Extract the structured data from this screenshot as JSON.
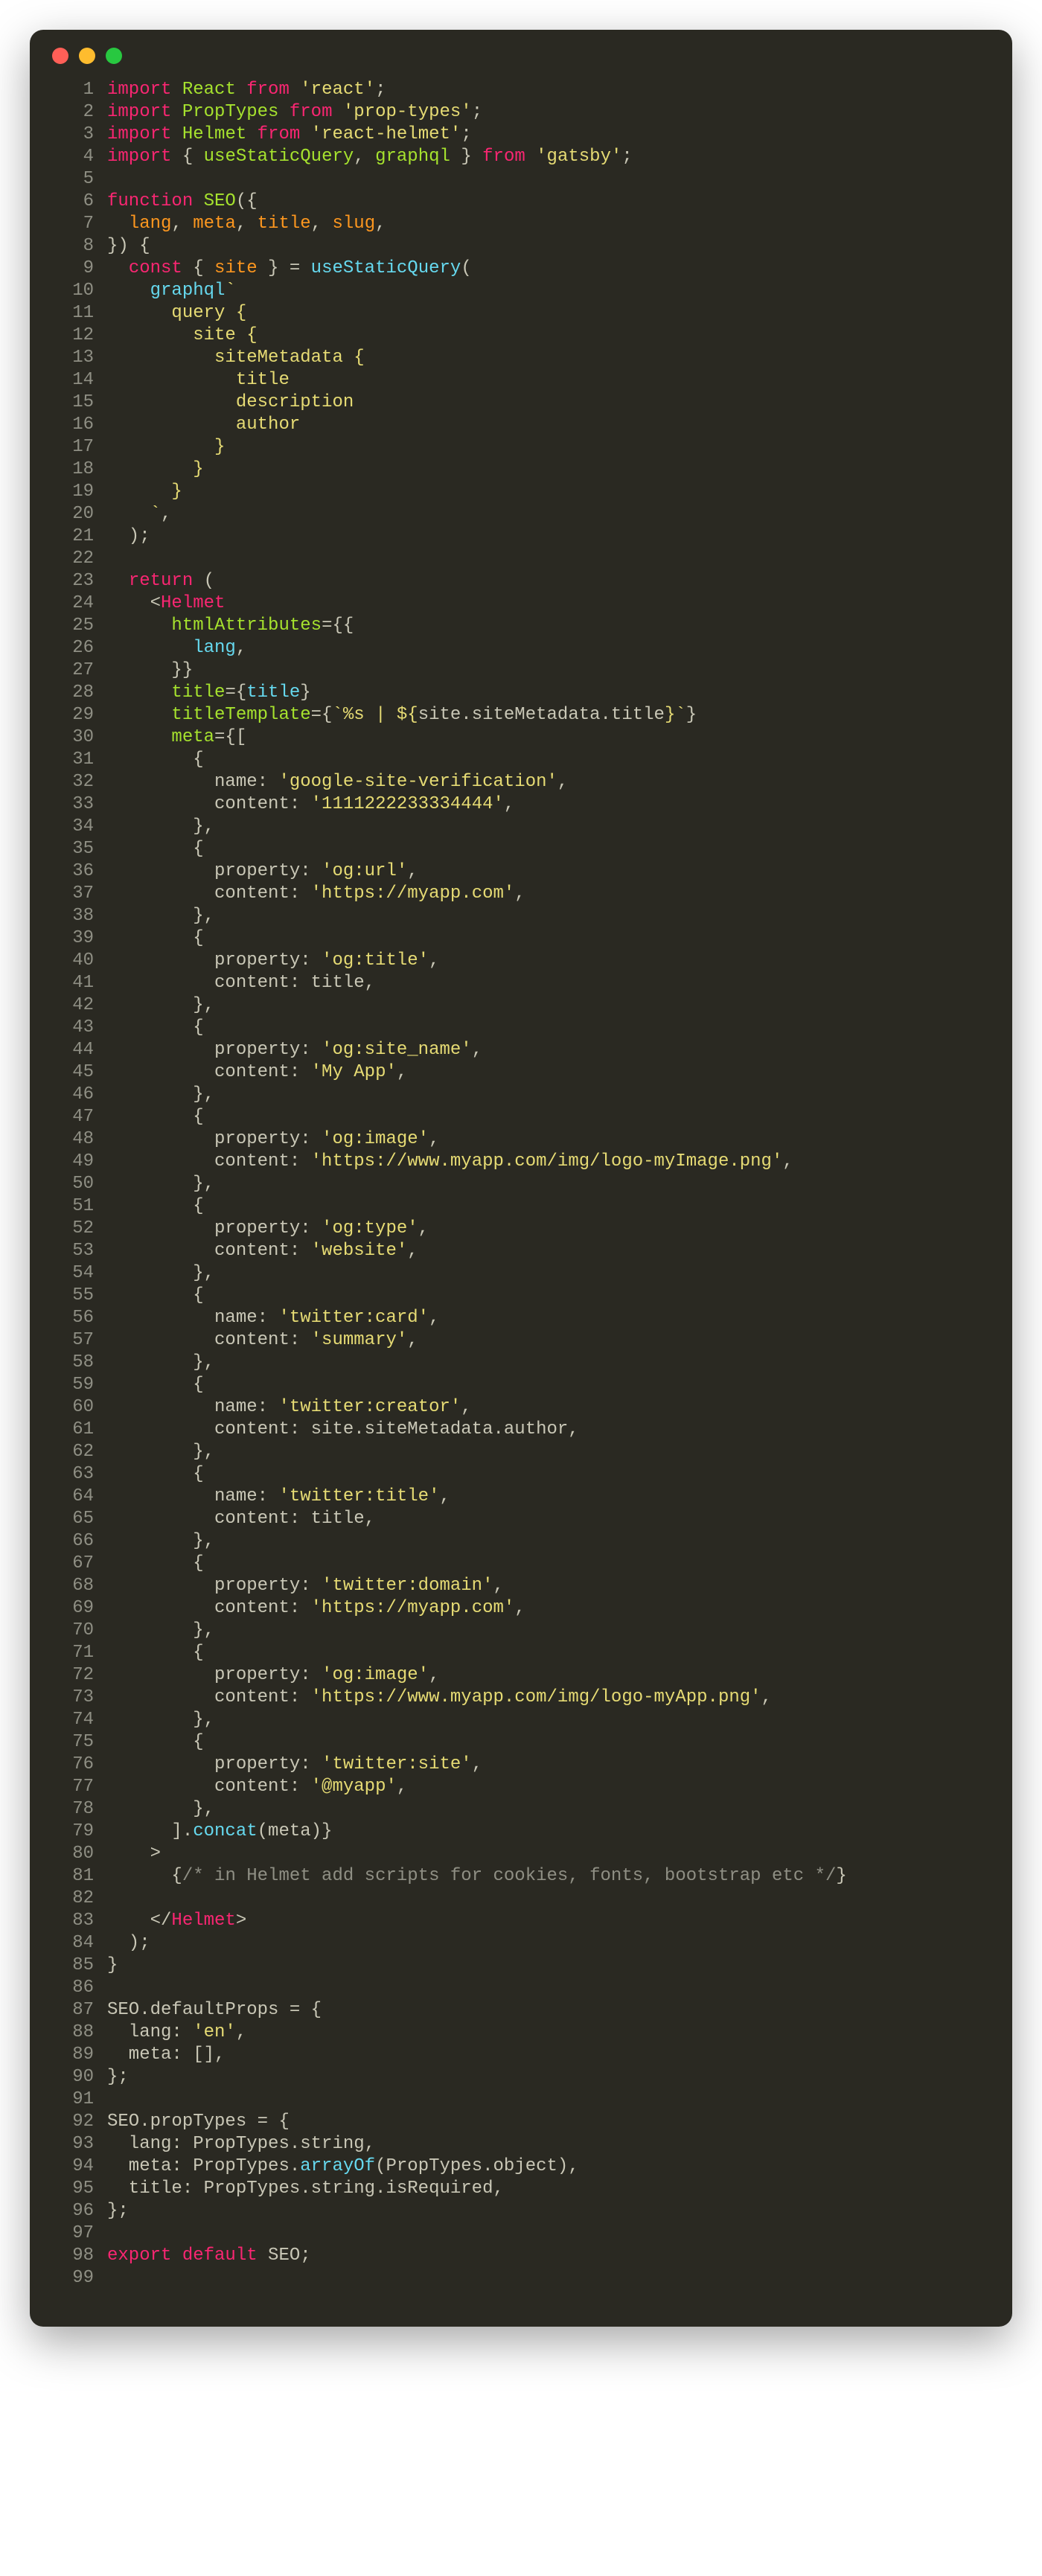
{
  "window": {
    "dots": [
      "close",
      "minimize",
      "zoom"
    ]
  },
  "code": {
    "lines": [
      [
        [
          "kw",
          "import"
        ],
        [
          "punc",
          " "
        ],
        [
          "name",
          "React"
        ],
        [
          "punc",
          " "
        ],
        [
          "kw",
          "from"
        ],
        [
          "punc",
          " "
        ],
        [
          "str",
          "'react'"
        ],
        [
          "punc",
          ";"
        ]
      ],
      [
        [
          "kw",
          "import"
        ],
        [
          "punc",
          " "
        ],
        [
          "name",
          "PropTypes"
        ],
        [
          "punc",
          " "
        ],
        [
          "kw",
          "from"
        ],
        [
          "punc",
          " "
        ],
        [
          "str",
          "'prop-types'"
        ],
        [
          "punc",
          ";"
        ]
      ],
      [
        [
          "kw",
          "import"
        ],
        [
          "punc",
          " "
        ],
        [
          "name",
          "Helmet"
        ],
        [
          "punc",
          " "
        ],
        [
          "kw",
          "from"
        ],
        [
          "punc",
          " "
        ],
        [
          "str",
          "'react-helmet'"
        ],
        [
          "punc",
          ";"
        ]
      ],
      [
        [
          "kw",
          "import"
        ],
        [
          "punc",
          " { "
        ],
        [
          "name",
          "useStaticQuery"
        ],
        [
          "punc",
          ", "
        ],
        [
          "name",
          "graphql"
        ],
        [
          "punc",
          " } "
        ],
        [
          "kw",
          "from"
        ],
        [
          "punc",
          " "
        ],
        [
          "str",
          "'gatsby'"
        ],
        [
          "punc",
          ";"
        ]
      ],
      [
        [
          "punc",
          ""
        ]
      ],
      [
        [
          "kw",
          "function"
        ],
        [
          "punc",
          " "
        ],
        [
          "name",
          "SEO"
        ],
        [
          "punc",
          "({"
        ]
      ],
      [
        [
          "punc",
          "  "
        ],
        [
          "param",
          "lang"
        ],
        [
          "punc",
          ", "
        ],
        [
          "param",
          "meta"
        ],
        [
          "punc",
          ", "
        ],
        [
          "param",
          "title"
        ],
        [
          "punc",
          ", "
        ],
        [
          "param",
          "slug"
        ],
        [
          "punc",
          ","
        ]
      ],
      [
        [
          "punc",
          "}) {"
        ]
      ],
      [
        [
          "punc",
          "  "
        ],
        [
          "kw",
          "const"
        ],
        [
          "punc",
          " { "
        ],
        [
          "param",
          "site"
        ],
        [
          "punc",
          " } = "
        ],
        [
          "fn",
          "useStaticQuery"
        ],
        [
          "punc",
          "("
        ]
      ],
      [
        [
          "punc",
          "    "
        ],
        [
          "fn",
          "graphql"
        ],
        [
          "str",
          "`"
        ]
      ],
      [
        [
          "str",
          "      query {"
        ]
      ],
      [
        [
          "str",
          "        site {"
        ]
      ],
      [
        [
          "str",
          "          siteMetadata {"
        ]
      ],
      [
        [
          "str",
          "            title"
        ]
      ],
      [
        [
          "str",
          "            description"
        ]
      ],
      [
        [
          "str",
          "            author"
        ]
      ],
      [
        [
          "str",
          "          }"
        ]
      ],
      [
        [
          "str",
          "        }"
        ]
      ],
      [
        [
          "str",
          "      }"
        ]
      ],
      [
        [
          "str",
          "    `"
        ],
        [
          "punc",
          ","
        ]
      ],
      [
        [
          "punc",
          "  );"
        ]
      ],
      [
        [
          "punc",
          ""
        ]
      ],
      [
        [
          "punc",
          "  "
        ],
        [
          "kw",
          "return"
        ],
        [
          "punc",
          " ("
        ]
      ],
      [
        [
          "punc",
          "    <"
        ],
        [
          "tag",
          "Helmet"
        ]
      ],
      [
        [
          "punc",
          "      "
        ],
        [
          "attr",
          "htmlAttributes"
        ],
        [
          "punc",
          "={{"
        ]
      ],
      [
        [
          "punc",
          "        "
        ],
        [
          "fn",
          "lang"
        ],
        [
          "punc",
          ","
        ]
      ],
      [
        [
          "punc",
          "      }}"
        ]
      ],
      [
        [
          "punc",
          "      "
        ],
        [
          "attr",
          "title"
        ],
        [
          "punc",
          "={"
        ],
        [
          "fn",
          "title"
        ],
        [
          "punc",
          "}"
        ]
      ],
      [
        [
          "punc",
          "      "
        ],
        [
          "attr",
          "titleTemplate"
        ],
        [
          "punc",
          "={"
        ],
        [
          "str",
          "`%s | ${"
        ],
        [
          "punc",
          "site.siteMetadata.title"
        ],
        [
          "str",
          "}`"
        ],
        [
          "punc",
          "}"
        ]
      ],
      [
        [
          "punc",
          "      "
        ],
        [
          "attr",
          "meta"
        ],
        [
          "punc",
          "={["
        ]
      ],
      [
        [
          "punc",
          "        {"
        ]
      ],
      [
        [
          "punc",
          "          name: "
        ],
        [
          "str",
          "'google-site-verification'"
        ],
        [
          "punc",
          ","
        ]
      ],
      [
        [
          "punc",
          "          content: "
        ],
        [
          "str",
          "'1111222233334444'"
        ],
        [
          "punc",
          ","
        ]
      ],
      [
        [
          "punc",
          "        },"
        ]
      ],
      [
        [
          "punc",
          "        {"
        ]
      ],
      [
        [
          "punc",
          "          property: "
        ],
        [
          "str",
          "'og:url'"
        ],
        [
          "punc",
          ","
        ]
      ],
      [
        [
          "punc",
          "          content: "
        ],
        [
          "str",
          "'https://myapp.com'"
        ],
        [
          "punc",
          ","
        ]
      ],
      [
        [
          "punc",
          "        },"
        ]
      ],
      [
        [
          "punc",
          "        {"
        ]
      ],
      [
        [
          "punc",
          "          property: "
        ],
        [
          "str",
          "'og:title'"
        ],
        [
          "punc",
          ","
        ]
      ],
      [
        [
          "punc",
          "          content: title,"
        ]
      ],
      [
        [
          "punc",
          "        },"
        ]
      ],
      [
        [
          "punc",
          "        {"
        ]
      ],
      [
        [
          "punc",
          "          property: "
        ],
        [
          "str",
          "'og:site_name'"
        ],
        [
          "punc",
          ","
        ]
      ],
      [
        [
          "punc",
          "          content: "
        ],
        [
          "str",
          "'My App'"
        ],
        [
          "punc",
          ","
        ]
      ],
      [
        [
          "punc",
          "        },"
        ]
      ],
      [
        [
          "punc",
          "        {"
        ]
      ],
      [
        [
          "punc",
          "          property: "
        ],
        [
          "str",
          "'og:image'"
        ],
        [
          "punc",
          ","
        ]
      ],
      [
        [
          "punc",
          "          content: "
        ],
        [
          "str",
          "'https://www.myapp.com/img/logo-myImage.png'"
        ],
        [
          "punc",
          ","
        ]
      ],
      [
        [
          "punc",
          "        },"
        ]
      ],
      [
        [
          "punc",
          "        {"
        ]
      ],
      [
        [
          "punc",
          "          property: "
        ],
        [
          "str",
          "'og:type'"
        ],
        [
          "punc",
          ","
        ]
      ],
      [
        [
          "punc",
          "          content: "
        ],
        [
          "str",
          "'website'"
        ],
        [
          "punc",
          ","
        ]
      ],
      [
        [
          "punc",
          "        },"
        ]
      ],
      [
        [
          "punc",
          "        {"
        ]
      ],
      [
        [
          "punc",
          "          name: "
        ],
        [
          "str",
          "'twitter:card'"
        ],
        [
          "punc",
          ","
        ]
      ],
      [
        [
          "punc",
          "          content: "
        ],
        [
          "str",
          "'summary'"
        ],
        [
          "punc",
          ","
        ]
      ],
      [
        [
          "punc",
          "        },"
        ]
      ],
      [
        [
          "punc",
          "        {"
        ]
      ],
      [
        [
          "punc",
          "          name: "
        ],
        [
          "str",
          "'twitter:creator'"
        ],
        [
          "punc",
          ","
        ]
      ],
      [
        [
          "punc",
          "          content: site.siteMetadata.author,"
        ]
      ],
      [
        [
          "punc",
          "        },"
        ]
      ],
      [
        [
          "punc",
          "        {"
        ]
      ],
      [
        [
          "punc",
          "          name: "
        ],
        [
          "str",
          "'twitter:title'"
        ],
        [
          "punc",
          ","
        ]
      ],
      [
        [
          "punc",
          "          content: title,"
        ]
      ],
      [
        [
          "punc",
          "        },"
        ]
      ],
      [
        [
          "punc",
          "        {"
        ]
      ],
      [
        [
          "punc",
          "          property: "
        ],
        [
          "str",
          "'twitter:domain'"
        ],
        [
          "punc",
          ","
        ]
      ],
      [
        [
          "punc",
          "          content: "
        ],
        [
          "str",
          "'https://myapp.com'"
        ],
        [
          "punc",
          ","
        ]
      ],
      [
        [
          "punc",
          "        },"
        ]
      ],
      [
        [
          "punc",
          "        {"
        ]
      ],
      [
        [
          "punc",
          "          property: "
        ],
        [
          "str",
          "'og:image'"
        ],
        [
          "punc",
          ","
        ]
      ],
      [
        [
          "punc",
          "          content: "
        ],
        [
          "str",
          "'https://www.myapp.com/img/logo-myApp.png'"
        ],
        [
          "punc",
          ","
        ]
      ],
      [
        [
          "punc",
          "        },"
        ]
      ],
      [
        [
          "punc",
          "        {"
        ]
      ],
      [
        [
          "punc",
          "          property: "
        ],
        [
          "str",
          "'twitter:site'"
        ],
        [
          "punc",
          ","
        ]
      ],
      [
        [
          "punc",
          "          content: "
        ],
        [
          "str",
          "'@myapp'"
        ],
        [
          "punc",
          ","
        ]
      ],
      [
        [
          "punc",
          "        },"
        ]
      ],
      [
        [
          "punc",
          "      ]."
        ],
        [
          "fn",
          "concat"
        ],
        [
          "punc",
          "(meta)}"
        ]
      ],
      [
        [
          "punc",
          "    >"
        ]
      ],
      [
        [
          "punc",
          "      {"
        ],
        [
          "cmt",
          "/* in Helmet add scripts for cookies, fonts, bootstrap etc */"
        ],
        [
          "punc",
          "}"
        ]
      ],
      [
        [
          "punc",
          ""
        ]
      ],
      [
        [
          "punc",
          "    </"
        ],
        [
          "tag",
          "Helmet"
        ],
        [
          "punc",
          ">"
        ]
      ],
      [
        [
          "punc",
          "  );"
        ]
      ],
      [
        [
          "punc",
          "}"
        ]
      ],
      [
        [
          "punc",
          ""
        ]
      ],
      [
        [
          "punc",
          "SEO.defaultProps = {"
        ]
      ],
      [
        [
          "punc",
          "  lang: "
        ],
        [
          "str",
          "'en'"
        ],
        [
          "punc",
          ","
        ]
      ],
      [
        [
          "punc",
          "  meta: [],"
        ]
      ],
      [
        [
          "punc",
          "};"
        ]
      ],
      [
        [
          "punc",
          ""
        ]
      ],
      [
        [
          "punc",
          "SEO.propTypes = {"
        ]
      ],
      [
        [
          "punc",
          "  lang: PropTypes.string,"
        ]
      ],
      [
        [
          "punc",
          "  meta: PropTypes."
        ],
        [
          "fn",
          "arrayOf"
        ],
        [
          "punc",
          "(PropTypes.object),"
        ]
      ],
      [
        [
          "punc",
          "  title: PropTypes.string.isRequired,"
        ]
      ],
      [
        [
          "punc",
          "};"
        ]
      ],
      [
        [
          "punc",
          ""
        ]
      ],
      [
        [
          "kw",
          "export default"
        ],
        [
          "punc",
          " SEO;"
        ]
      ],
      [
        [
          "punc",
          ""
        ]
      ]
    ]
  }
}
